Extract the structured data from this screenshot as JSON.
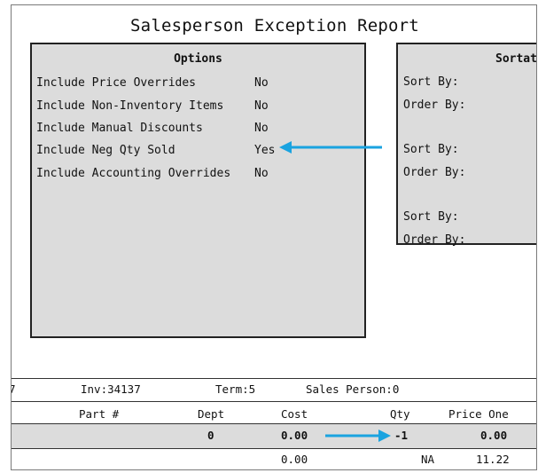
{
  "report": {
    "title": "Salesperson Exception Report"
  },
  "options": {
    "heading": "Options",
    "items": [
      {
        "label": "Include Price Overrides",
        "value": "No"
      },
      {
        "label": "Include Non-Inventory Items",
        "value": "No"
      },
      {
        "label": "Include Manual Discounts",
        "value": "No"
      },
      {
        "label": "Include Neg Qty Sold",
        "value": "Yes"
      },
      {
        "label": "Include Accounting Overrides",
        "value": "No"
      }
    ]
  },
  "sortation": {
    "heading": "Sortat",
    "labels": [
      "Sort By:",
      "Order By:",
      "Sort By:",
      "Order By:",
      "Sort By:",
      "Order By:"
    ]
  },
  "invoice": {
    "left_fragment": "7",
    "inv": "Inv:34137",
    "term": "Term:5",
    "salesperson": "Sales Person:0"
  },
  "table": {
    "headers": {
      "part": "Part #",
      "dept": "Dept",
      "cost": "Cost",
      "qty": "Qty",
      "price_one": "Price One"
    },
    "rows": [
      {
        "part": "",
        "dept": "0",
        "cost": "0.00",
        "qty": "-1",
        "price_one": "0.00"
      },
      {
        "part": "",
        "dept": "",
        "cost": "0.00",
        "qty": "NA",
        "price_one": "11.22"
      }
    ]
  },
  "colors": {
    "annotation_arrow": "#1aa3e0",
    "panel_bg": "#dcdcdc"
  }
}
